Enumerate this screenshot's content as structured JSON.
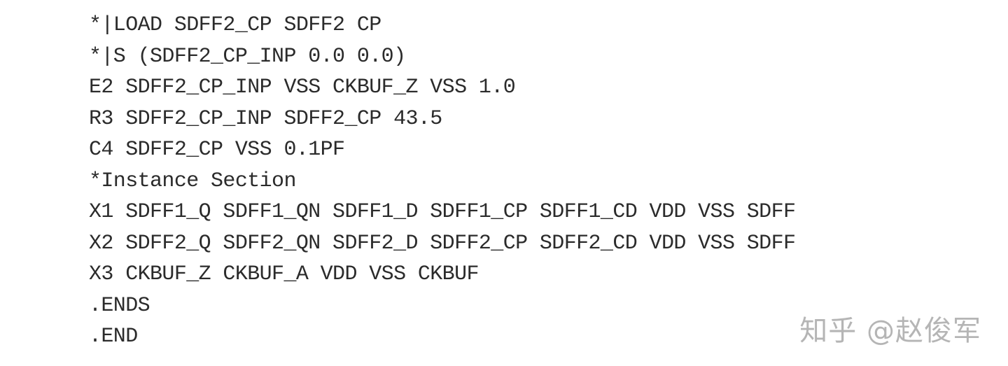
{
  "document": {
    "lines": [
      "*|LOAD SDFF2_CP SDFF2 CP",
      "*|S (SDFF2_CP_INP 0.0 0.0)",
      "E2 SDFF2_CP_INP VSS CKBUF_Z VSS 1.0",
      "R3 SDFF2_CP_INP SDFF2_CP 43.5",
      "C4 SDFF2_CP VSS 0.1PF",
      "*Instance Section",
      "X1 SDFF1_Q SDFF1_QN SDFF1_D SDFF1_CP SDFF1_CD VDD VSS SDFF",
      "X2 SDFF2_Q SDFF2_QN SDFF2_D SDFF2_CP SDFF2_CD VDD VSS SDFF",
      "X3 CKBUF_Z CKBUF_A VDD VSS CKBUF",
      ".ENDS",
      ".END"
    ]
  },
  "watermark": {
    "text": "知乎 @赵俊军"
  },
  "colors": {
    "text": "#2b2b2b",
    "background": "#ffffff",
    "watermark": "#8a8a8a"
  }
}
